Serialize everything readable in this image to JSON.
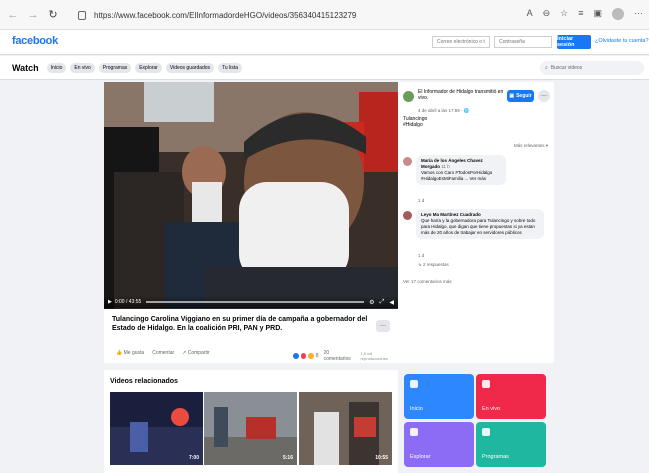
{
  "browser": {
    "url": "https://www.facebook.com/ElInformadordeHGO/videos/356340415123279",
    "icons": [
      "back-icon",
      "forward-icon",
      "refresh-icon",
      "lock-icon",
      "read-aloud-icon",
      "zoom-icon",
      "favorite-icon",
      "favorites-bar-icon",
      "collections-icon",
      "profile-icon",
      "more-icon"
    ]
  },
  "header": {
    "logo": "facebook",
    "email_placeholder": "Correo electrónico o tel",
    "password_placeholder": "Contraseña",
    "login_label": "Iniciar sesión",
    "forgot_label": "¿Olvidaste tu cuenta?"
  },
  "watch": {
    "title": "Watch",
    "tabs": [
      "Inicio",
      "En vivo",
      "Programas",
      "Explorar",
      "Videos guardados",
      "Tu lista"
    ],
    "search_placeholder": "Buscar videos"
  },
  "player": {
    "time": "0:00 / 43:55"
  },
  "post": {
    "page_name": "El Informador de Hidalgo transmitió en vivo.",
    "date": "4 de abril a las 17:59 · 🌐",
    "text_line1": "Tulancingo",
    "text_line2": "#Hidalgo",
    "follow_label": "Seguir",
    "relevant_label": "Más relevantes ▾",
    "comments": [
      {
        "name": "María de los Ángeles Chavez Morgado",
        "time": "11 h",
        "text": "Vamos con Caro #TodosPorHidalgo #HidalgoEsMiFamilia ... Ver más",
        "meta": "1 d"
      },
      {
        "name": "Leyo Ma Martínez Cuadrado",
        "time": "",
        "text": "Que haría y la gobernadora para Tulancingo y sobre todo para Hidalgo, que digan que tiene propuestas si ya estan más de 20 años de trabajar en servidores públicos",
        "meta": "1 d",
        "replies": "↳ 2 respuestas"
      }
    ],
    "view_more": "Ver 17 comentarios más"
  },
  "video": {
    "title": "Tulancingo Carolina Viggiano en su primer día de campaña a gobernador del Estado de Hidalgo. En la coalición PRI, PAN y PRD.",
    "like_label": "Me gusta",
    "comment_label": "Comentar",
    "share_label": "Compartir",
    "reaction_count": "8",
    "comments_count": "20 comentarios",
    "views": "1,5 mil reproducciones"
  },
  "related": {
    "title": "Videos relacionados",
    "items": [
      {
        "duration": "7:00"
      },
      {
        "duration": "5:16"
      },
      {
        "duration": "10:55"
      }
    ]
  },
  "tiles": [
    {
      "label": "Inicio",
      "color": "#2d88ff"
    },
    {
      "label": "En vivo",
      "color": "#f02849"
    },
    {
      "label": "Explorar",
      "color": "#8c6cf5"
    },
    {
      "label": "Programas",
      "color": "#20b7a0"
    }
  ]
}
